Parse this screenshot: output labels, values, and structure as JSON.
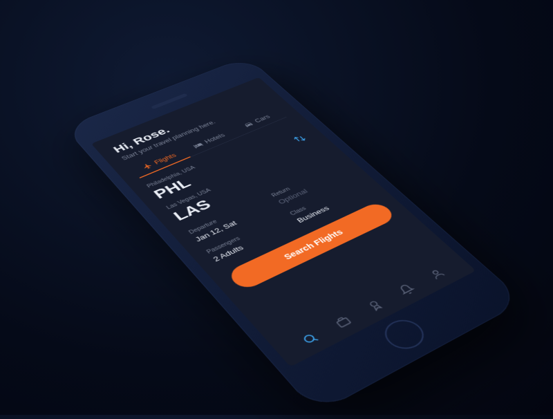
{
  "greeting": "Hi, Rose.",
  "subtitle": "Start your travel planning here.",
  "tabs": {
    "flights": "Flights",
    "hotels": "Hotels",
    "cars": "Cars"
  },
  "origin": {
    "label": "Philadelphia, USA",
    "code": "PHL"
  },
  "destination": {
    "label": "Las Vegas, USA",
    "code": "LAS"
  },
  "departure": {
    "label": "Departure",
    "value": "Jan 12, Sat"
  },
  "ret": {
    "label": "Return",
    "value": "Optional"
  },
  "passengers": {
    "label": "Passengers",
    "value": "2 Adults"
  },
  "travelClass": {
    "label": "Class",
    "value": "Business"
  },
  "cta": "Search Flights",
  "colors": {
    "accent": "#f26a24",
    "link": "#3fa9f5",
    "bg": "#161c2e"
  }
}
